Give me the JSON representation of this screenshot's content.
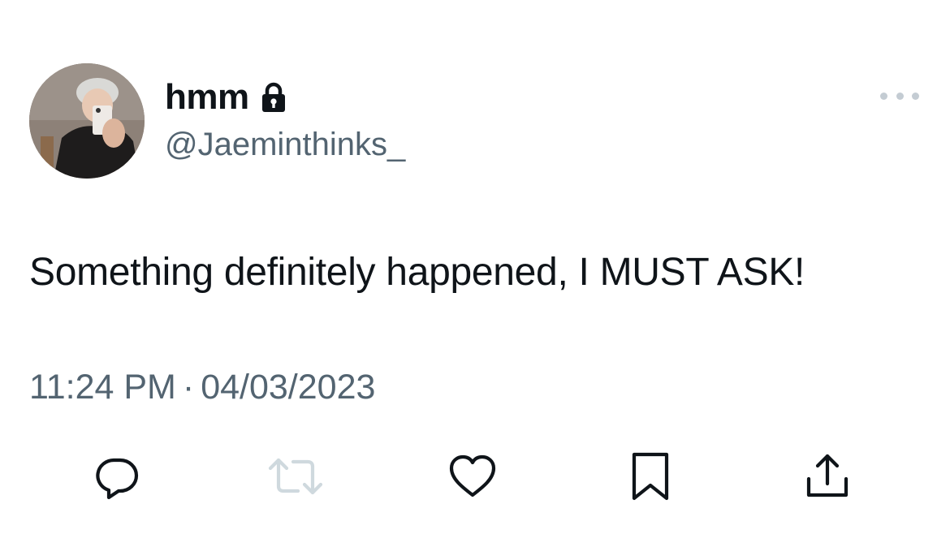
{
  "tweet": {
    "display_name": "hmm",
    "handle": "@Jaeminthinks_",
    "protected_icon": "lock-icon",
    "more_icon": "more-horizontal-icon",
    "text": "Something definitely happened, I MUST ASK!",
    "time": "11:24 PM",
    "separator": "·",
    "date": "04/03/2023"
  },
  "actions": [
    {
      "name": "reply",
      "icon": "reply-icon"
    },
    {
      "name": "retweet",
      "icon": "retweet-icon",
      "disabled": true
    },
    {
      "name": "like",
      "icon": "heart-icon"
    },
    {
      "name": "bookmark",
      "icon": "bookmark-icon"
    },
    {
      "name": "share",
      "icon": "share-icon"
    }
  ],
  "colors": {
    "text": "#0f1419",
    "secondary": "#536471",
    "icon": "#536471",
    "disabled_icon": "#cfd9de",
    "background": "#ffffff"
  }
}
